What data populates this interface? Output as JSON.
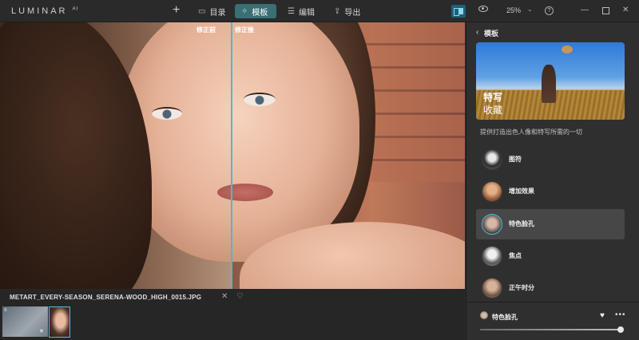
{
  "app": {
    "logo": "LUMINAR",
    "logo_sup": "AI"
  },
  "toolbar": {
    "add_icon": "plus-icon",
    "catalog_label": "目录",
    "templates_label": "模板",
    "edit_label": "编辑",
    "export_label": "导出",
    "zoom": "25%"
  },
  "photo": {
    "before_label": "修正前",
    "after_label": "修正後"
  },
  "filmstrip": {
    "filename": "METART_EVERY-SEASON_SERENA-WOOD_HIGH_0015.JPG"
  },
  "panel": {
    "back_label": "模板",
    "hero_title": "特写",
    "hero_subtitle": "收藏",
    "description": "提供打造出色人像和特写所需的一切",
    "items": [
      {
        "label": "图符",
        "active": false
      },
      {
        "label": "增加效果",
        "active": false
      },
      {
        "label": "特色脸孔",
        "active": true
      },
      {
        "label": "焦点",
        "active": false
      },
      {
        "label": "正午时分",
        "active": false
      }
    ],
    "selected": {
      "label": "特色脸孔",
      "amount_fraction": 1.0
    }
  },
  "colors": {
    "accent": "#4fb6d8",
    "active_tab": "#3a6f74"
  }
}
